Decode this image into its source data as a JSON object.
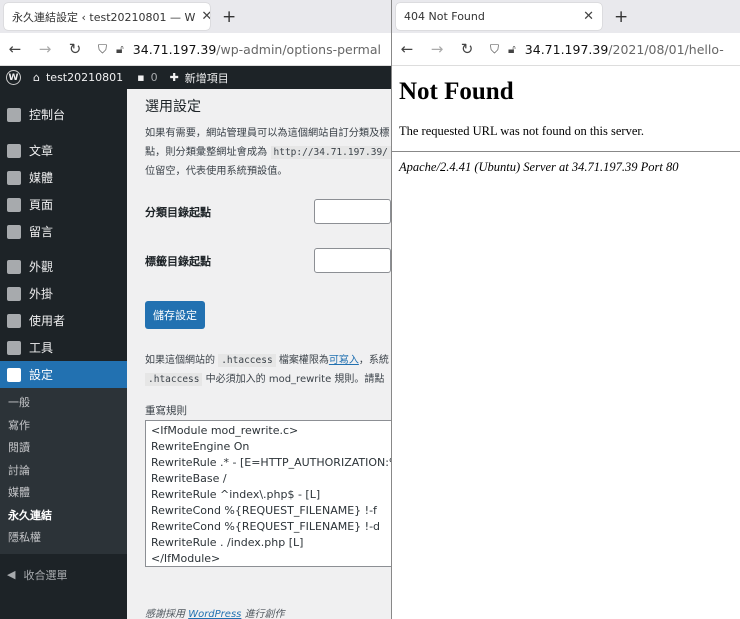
{
  "left_window": {
    "tab_title": "永久連結設定 ‹ test20210801 — W",
    "close_symbol": "✕",
    "newtab_symbol": "+",
    "url_host": "34.71.197.39",
    "url_path": "/wp-admin/options-permal",
    "admin_bar": {
      "wp_logo": "W",
      "site_name": "test20210801",
      "comments_count": "0",
      "new_item": "新增項目"
    },
    "sidebar": {
      "items": [
        {
          "label": "控制台"
        },
        {
          "label": "文章"
        },
        {
          "label": "媒體"
        },
        {
          "label": "頁面"
        },
        {
          "label": "留言"
        },
        {
          "label": "外觀"
        },
        {
          "label": "外掛"
        },
        {
          "label": "使用者"
        },
        {
          "label": "工具"
        },
        {
          "label": "設定"
        }
      ],
      "submenu": [
        "一般",
        "寫作",
        "閱讀",
        "討論",
        "媒體",
        "永久連結",
        "隱私權"
      ],
      "collapse": "收合選單"
    },
    "content": {
      "heading": "選用設定",
      "desc_line1": "如果有需要，網站管理員可以為這個網站自訂分類及標",
      "desc_line2_pre": "點，則分類彙整網址會成為",
      "desc_line2_code": "http://34.71.197.39/",
      "desc_line3": "位留空，代表使用系統預設值。",
      "category_base_label": "分類目錄起點",
      "tag_base_label": "標籤目錄起點",
      "save_button": "儲存設定",
      "info_pre": "如果這個網站的",
      "info_code1": ".htaccess",
      "info_mid": "檔案權限為",
      "info_link": "可寫入",
      "info_post": "，系統",
      "info_code2": ".htaccess",
      "info_line2": "中必須加入的 mod_rewrite 規則。請點",
      "rewrite_label": "重寫規則",
      "rewrite_rules": [
        "<IfModule mod_rewrite.c>",
        "RewriteEngine On",
        "RewriteRule .* - [E=HTTP_AUTHORIZATION:%{HT",
        "RewriteBase /",
        "RewriteRule ^index\\.php$ - [L]",
        "RewriteCond %{REQUEST_FILENAME} !-f",
        "RewriteCond %{REQUEST_FILENAME} !-d",
        "RewriteRule . /index.php [L]",
        "</IfModule>"
      ],
      "footer_pre": "感謝採用",
      "footer_link": "WordPress",
      "footer_post": "進行創作"
    }
  },
  "right_window": {
    "tab_title": "404 Not Found",
    "close_symbol": "✕",
    "newtab_symbol": "+",
    "url_host": "34.71.197.39",
    "url_path": "/2021/08/01/hello-",
    "heading": "Not Found",
    "message": "The requested URL was not found on this server.",
    "server_signature": "Apache/2.4.41 (Ubuntu) Server at 34.71.197.39 Port 80"
  },
  "colors": {
    "wp_dark": "#1d2327",
    "wp_blue": "#2271b1",
    "wp_bg": "#f0f0f1"
  }
}
